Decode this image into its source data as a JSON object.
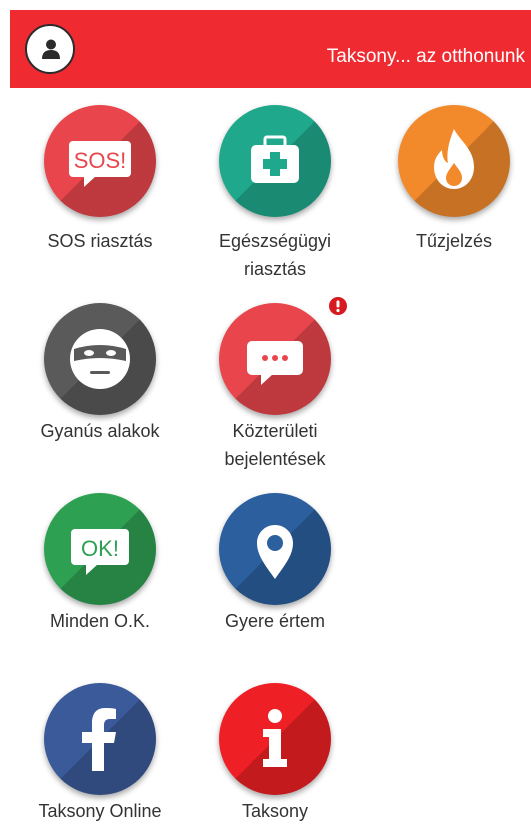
{
  "header": {
    "title": "Taksony... az otthonunk",
    "avatar_icon": "user-icon",
    "color": "#ef2b31"
  },
  "tiles": [
    {
      "label": "SOS riasztás",
      "icon": "sos-speech-bubble-icon",
      "color": "#e8464c"
    },
    {
      "label": "Egészségügyi riasztás",
      "icon": "first-aid-kit-icon",
      "color": "#1fa88c"
    },
    {
      "label": "Tűzjelzés",
      "icon": "fire-icon",
      "color": "#f28a2c"
    },
    {
      "label": "Gyanús alakok",
      "icon": "masked-face-icon",
      "color": "#5a5a5a"
    },
    {
      "label": "Közterületi bejelentések",
      "icon": "chat-bubble-icon",
      "color": "#e8464c",
      "badge_icon": "alert-badge-icon"
    },
    {
      "label": "Minden O.K.",
      "icon": "ok-speech-bubble-icon",
      "color": "#2ea052"
    },
    {
      "label": "Gyere értem",
      "icon": "map-pin-icon",
      "color": "#2b5f9e"
    },
    {
      "label": "Taksony Online",
      "icon": "facebook-icon",
      "color": "#3b5a9a"
    },
    {
      "label": "Taksony",
      "icon": "info-icon",
      "color": "#ee2025"
    }
  ]
}
